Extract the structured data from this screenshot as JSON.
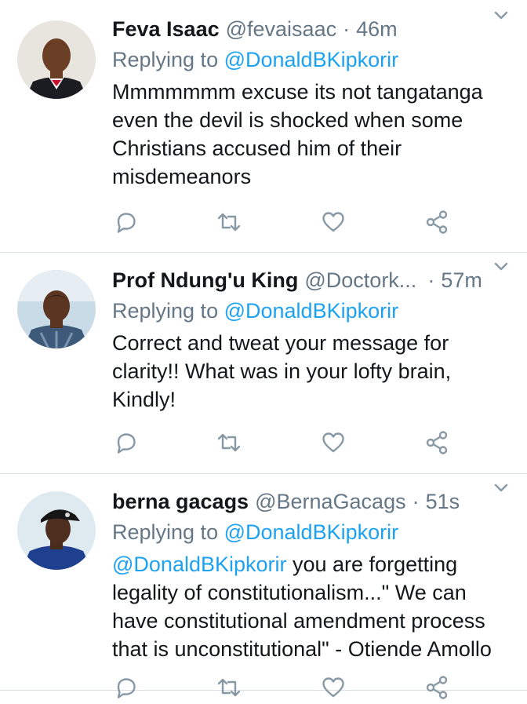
{
  "tweets": [
    {
      "name": "Feva Isaac",
      "handle": "@fevaisaac",
      "dot": "·",
      "time": "46m",
      "replying_prefix": "Replying to ",
      "replying_to": "@DonaldBKipkorir",
      "text_lines": [
        "Mmmmmmm excuse its not tangatanga",
        "even the devil is shocked when some",
        "Christians accused him of their",
        "misdemeanors"
      ]
    },
    {
      "name": "Prof Ndung'u King",
      "handle": "@Doctork...",
      "dot": "·",
      "time": "57m",
      "replying_prefix": "Replying to ",
      "replying_to": "@DonaldBKipkorir",
      "text_lines": [
        "Correct and tweat your message for",
        "clarity!! What was in your lofty brain,",
        "Kindly!"
      ]
    },
    {
      "name": "berna gacags",
      "handle": "@BernaGacags",
      "dot": "·",
      "time": "51s",
      "replying_prefix": "Replying to ",
      "replying_to": "@DonaldBKipkorir",
      "mention": "@DonaldBKipkorir",
      "text_first": " you are forgetting",
      "text_lines": [
        "legality of constitutionalism...\" We can",
        "have constitutional amendment process",
        "that is unconstitutional\" - Otiende Amollo"
      ]
    }
  ],
  "icons": [
    "reply-icon",
    "retweet-icon",
    "like-icon",
    "share-icon",
    "chevron-down-icon"
  ],
  "colors": {
    "link": "#1da1f2",
    "muted": "#657786",
    "text": "#14171a",
    "divider": "#d9dfe4"
  }
}
